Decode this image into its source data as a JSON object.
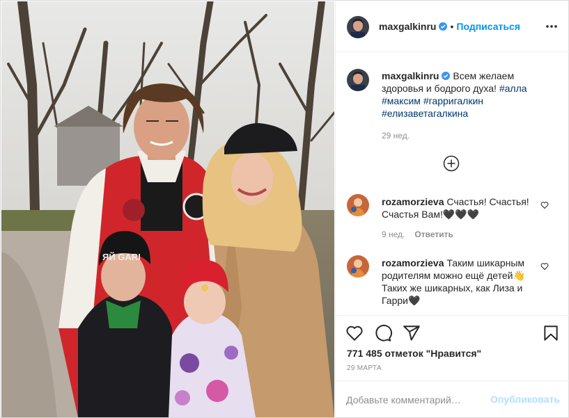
{
  "post": {
    "photo_alt": "family photo",
    "header": {
      "username": "maxgalkinru",
      "verified_icon": "verified-badge-icon",
      "separator": "•",
      "follow_label": "Подписаться",
      "more_icon": "more-options-icon"
    },
    "caption": {
      "username": "maxgalkinru",
      "text": "Всем желаем здоровья и бодрого духа!",
      "hashtags": [
        "#алла",
        "#максим",
        "#гарригалкин",
        "#елизаветагалкина"
      ],
      "time": "29 нед."
    },
    "load_more_icon": "plus-circle-icon",
    "comments": [
      {
        "username": "rozamorzieva",
        "text": "Счастья! Счастья! Счастья Вам!🖤🖤🖤",
        "time": "9 нед.",
        "reply_label": "Ответить",
        "like_icon": "heart-outline-icon"
      },
      {
        "username": "rozamorzieva",
        "text": "Таким шикарным родителям можно ещё детей👋 Таких же шикарных, как Лиза и Гарри🖤",
        "like_icon": "heart-outline-icon"
      }
    ],
    "actions": {
      "like_icon": "heart-icon",
      "comment_icon": "comment-icon",
      "share_icon": "share-icon",
      "save_icon": "bookmark-icon"
    },
    "likes": "771 485 отметок \"Нравится\"",
    "date": "29 МАРТА",
    "add_comment": {
      "placeholder": "Добавьте комментарий…",
      "publish_label": "Опубликовать"
    },
    "colors": {
      "accent": "#0095f6",
      "accent_disabled": "#b2dffc",
      "hashtag": "#00376b",
      "muted": "#8e8e8e",
      "border": "#dbdbdb"
    }
  }
}
